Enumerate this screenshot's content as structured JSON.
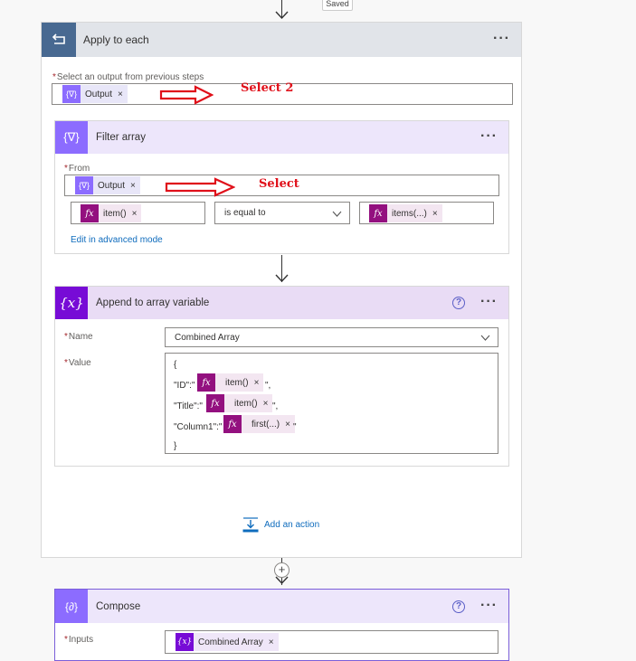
{
  "status": {
    "saved_label": "Saved"
  },
  "apply_to_each": {
    "title": "Apply to each",
    "menu_icon": "more-icon",
    "output_label": "Select an output from previous steps",
    "output_token": "Output",
    "annotation": "Select 2"
  },
  "filter_array": {
    "title": "Filter array",
    "from_label": "From",
    "from_token": "Output",
    "annotation": "Select",
    "left_token": "item()",
    "operator": "is equal to",
    "right_token": "items(...)",
    "advanced_link": "Edit in advanced mode"
  },
  "append_array": {
    "title": "Append to array variable",
    "name_label": "Name",
    "name_value": "Combined Array",
    "value_label": "Value",
    "value_lines": {
      "open": "{",
      "id_key": "\"ID\":\"",
      "id_token": "item()",
      "id_suffix": "\",",
      "title_key": "\"Title\":\"",
      "title_token": "item()",
      "title_suffix": "\",",
      "col_key": "\"Column1\":\"",
      "col_token": "first(...)",
      "col_suffix": "\"",
      "close": "}"
    }
  },
  "add_action": {
    "label": "Add an action"
  },
  "compose": {
    "title": "Compose",
    "inputs_label": "Inputs",
    "inputs_token": "Combined Array"
  },
  "colors": {
    "loop_header": "#e1e4e9",
    "loop_icon_bg": "#486991",
    "filter_header": "#ede6fb",
    "filter_icon_bg": "#8c6cff",
    "variable_header": "#e9dcf5",
    "variable_icon_bg": "#770bd6",
    "red_annotation": "#e0101a"
  }
}
